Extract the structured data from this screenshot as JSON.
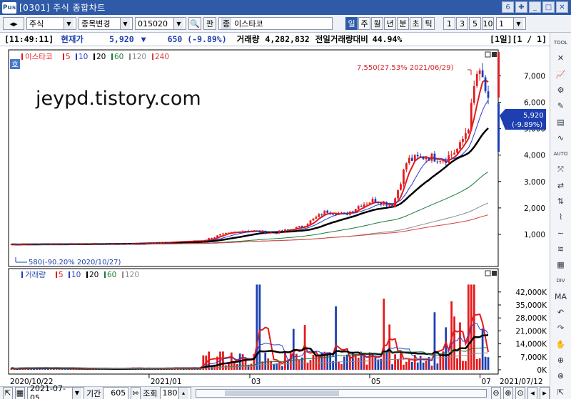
{
  "window": {
    "logo": "Pus",
    "title": "[0301] 주식 종합차트",
    "page_num": "6",
    "btn_pin": "✚",
    "btn_min": "_",
    "btn_max": "□",
    "btn_close": "✕"
  },
  "toolbar": {
    "market": "주식",
    "mode": "종목변경",
    "code": "015020",
    "search_icon": "🔍",
    "pan_label": "판",
    "stock_badge": "종",
    "stock_name": "이스타코",
    "periods": [
      "일",
      "주",
      "월",
      "년",
      "분",
      "초",
      "틱"
    ],
    "selected_period": "일",
    "intervals": [
      "1",
      "3",
      "5",
      "10"
    ],
    "interval_value": "1"
  },
  "info": {
    "time": "[11:49:11]",
    "price_label": "현재가",
    "price": "5,920",
    "arrow": "▼",
    "change": "650 (-9.89%)",
    "volume_label": "거래량",
    "volume": "4,282,832",
    "prev_ratio_label": "전일거래량대비",
    "prev_ratio": "44.94%",
    "period_info": "[1일][1 / 1]"
  },
  "price_panel": {
    "legend_name": "이스타코",
    "ma_labels": [
      "5",
      "10",
      "20",
      "60",
      "120",
      "240"
    ],
    "ma_colors": [
      "#e41a1c",
      "#2b3cc9",
      "#000000",
      "#1b7a3a",
      "#8a8a8a",
      "#d6413a"
    ],
    "hoga_badge": "호",
    "watermark": "jeypd.tistory.com",
    "high_annotation": "7,550(27.53% 2021/06/29)",
    "low_annotation": "580(-90.20% 2020/10/27)",
    "current_tag_price": "5,920",
    "current_tag_change": "(-9.89%)",
    "y_ticks": [
      {
        "label": "7,000",
        "value": 7000
      },
      {
        "label": "6,000",
        "value": 6000
      },
      {
        "label": "5,000",
        "value": 5000
      },
      {
        "label": "4,000",
        "value": 4000
      },
      {
        "label": "3,000",
        "value": 3000
      },
      {
        "label": "2,000",
        "value": 2000
      },
      {
        "label": "1,000",
        "value": 1000
      }
    ]
  },
  "volume_panel": {
    "legend_name": "거래량",
    "ma_labels": [
      "5",
      "10",
      "20",
      "60",
      "120"
    ],
    "ma_colors": [
      "#e41a1c",
      "#2b3cc9",
      "#000000",
      "#1b7a3a",
      "#8a8a8a"
    ],
    "y_ticks": [
      {
        "label": "42,000K",
        "value": 42000
      },
      {
        "label": "35,000K",
        "value": 35000
      },
      {
        "label": "28,000K",
        "value": 28000
      },
      {
        "label": "21,000K",
        "value": 21000
      },
      {
        "label": "14,000K",
        "value": 14000
      },
      {
        "label": "7,000K",
        "value": 7000
      },
      {
        "label": "0K",
        "value": 0
      }
    ]
  },
  "x_axis": {
    "start_date": "2020/10/22",
    "end_date": "2021/07/12",
    "month_labels": [
      {
        "label": "2021/01",
        "pos": 0.29
      },
      {
        "label": "03",
        "pos": 0.5
      },
      {
        "label": "05",
        "pos": 0.75
      },
      {
        "label": "07",
        "pos": 0.98
      }
    ]
  },
  "status": {
    "date": "2021-07-05",
    "period_label": "기간",
    "period_value": "605",
    "query_label": "조회",
    "query_value": "180"
  },
  "sidebar": {
    "items": [
      "TOOL",
      "✕",
      "📈",
      "⚙",
      "✎",
      "▤",
      "∿",
      "AUTO",
      "⤧",
      "⇄",
      "⇅",
      "⌇",
      "∼",
      "≋",
      "▦",
      "DIV",
      "MA",
      "↶",
      "↷",
      "✋",
      "⊕",
      "⊗",
      "⇱"
    ]
  }
}
